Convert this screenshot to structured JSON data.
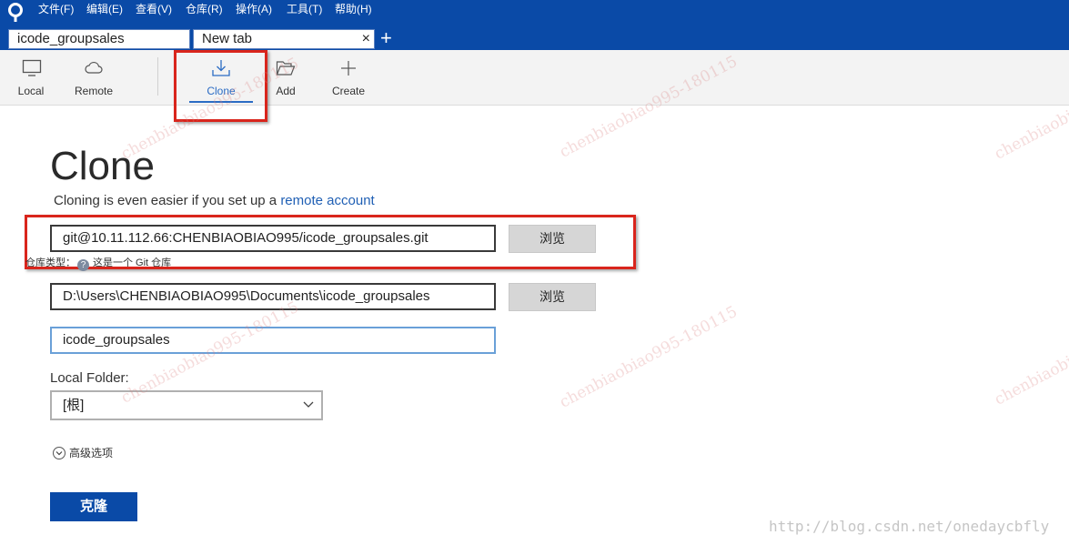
{
  "menu": [
    "文件(F)",
    "编辑(E)",
    "查看(V)",
    "仓库(R)",
    "操作(A)",
    "工具(T)",
    "帮助(H)"
  ],
  "tabs": [
    {
      "label": "icode_groupsales"
    },
    {
      "label": "New tab",
      "close": "×"
    }
  ],
  "tab_add": "+",
  "toolbar": {
    "local": "Local",
    "remote": "Remote",
    "clone": "Clone",
    "add": "Add",
    "create": "Create"
  },
  "main": {
    "title": "Clone",
    "subtitle_prefix": "Cloning is even easier if you set up a ",
    "subtitle_link": "remote account",
    "source_url": "git@10.11.112.66:CHENBIAOBIAO995/icode_groupsales.git",
    "browse": "浏览",
    "repo_type_label": "仓库类型：",
    "repo_type_help": "?",
    "repo_type_value": "这是一个 Git 仓库",
    "dest_path": "D:\\Users\\CHENBIAOBIAO995\\Documents\\icode_groupsales",
    "name": "icode_groupsales",
    "local_folder_label": "Local Folder:",
    "local_folder_value": "[根]",
    "advanced": "高级选项",
    "submit": "克隆"
  },
  "watermark": "chenbiaobiao995-180115",
  "source_mark": "http://blog.csdn.net/onedaycbfly",
  "colors": {
    "menubar": "#0a4aa7",
    "highlight": "#d9251c",
    "link": "#1f5fb4",
    "primary": "#0a4aa7"
  }
}
